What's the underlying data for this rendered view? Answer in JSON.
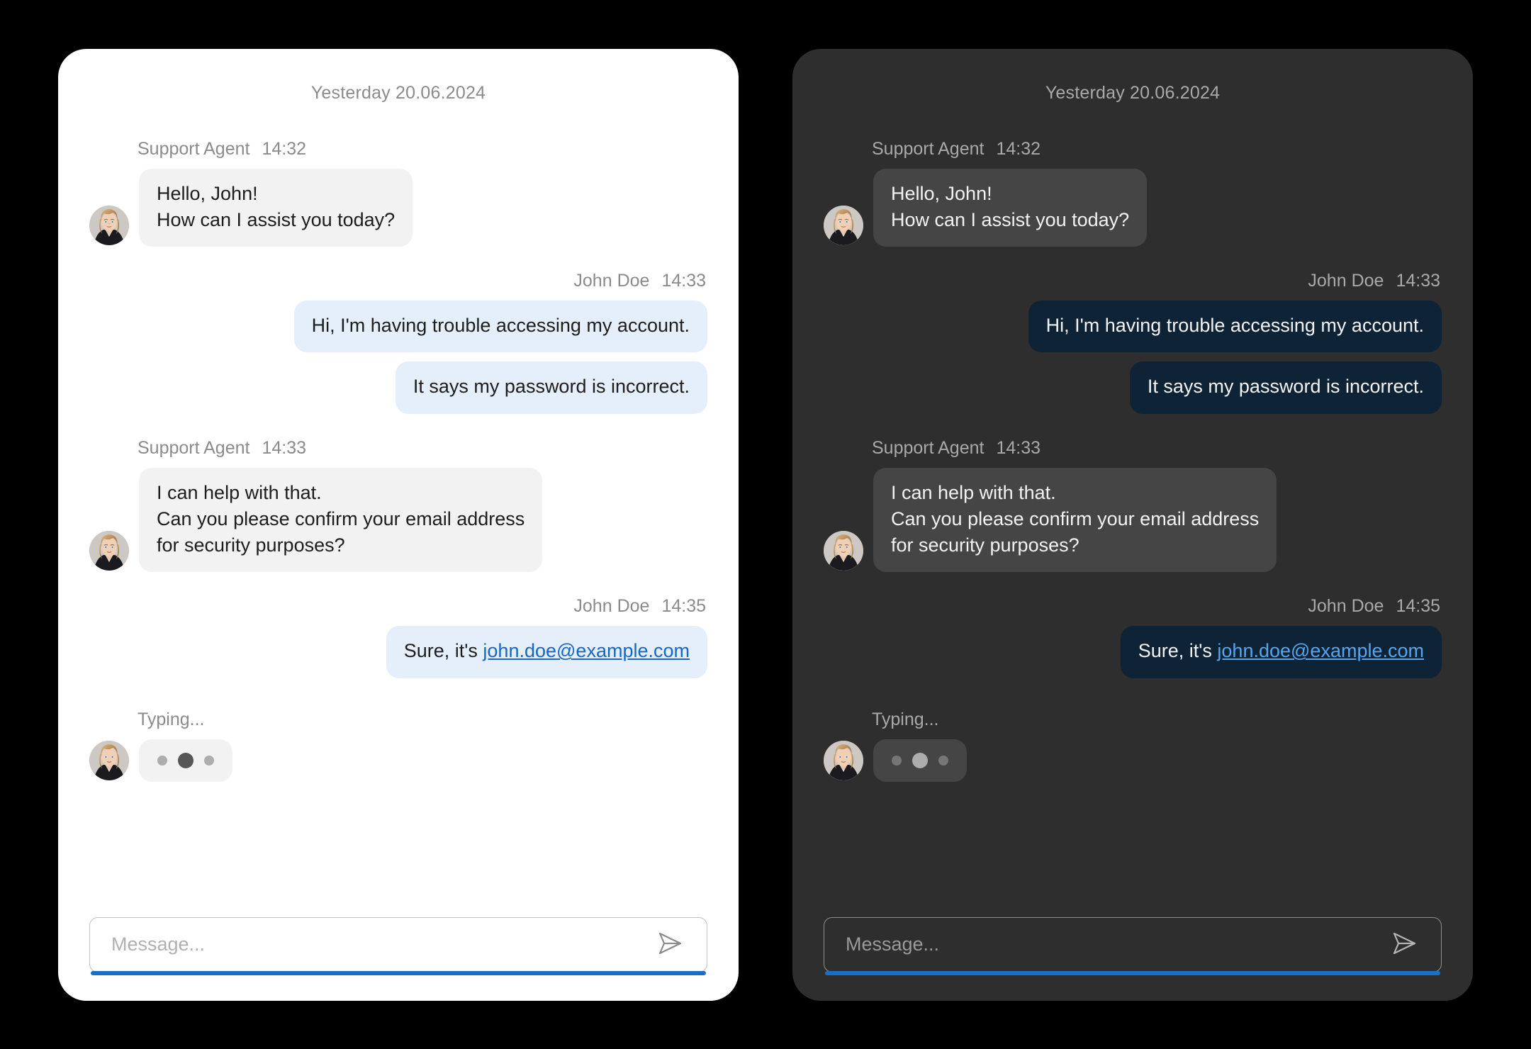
{
  "panels": [
    {
      "theme": "light",
      "name": "chat-panel-light"
    },
    {
      "theme": "dark",
      "name": "chat-panel-dark"
    }
  ],
  "date_divider": "Yesterday 20.06.2024",
  "messages": [
    {
      "side": "in",
      "sender": "Support Agent",
      "time": "14:32",
      "bubbles": [
        "Hello, John!\nHow can I assist you today?"
      ]
    },
    {
      "side": "out",
      "sender": "John Doe",
      "time": "14:33",
      "bubbles": [
        "Hi, I'm having trouble accessing my account.",
        "It says my password is incorrect."
      ]
    },
    {
      "side": "in",
      "sender": "Support Agent",
      "time": "14:33",
      "bubbles": [
        "I can help with that.\nCan you please confirm your email address\nfor security purposes?"
      ]
    },
    {
      "side": "out",
      "sender": "John Doe",
      "time": "14:35",
      "bubbles": [],
      "link_message": {
        "prefix": "Sure, it's ",
        "link": "john.doe@example.com"
      }
    }
  ],
  "typing": {
    "label": "Typing...",
    "dots": [
      "small",
      "large",
      "small"
    ]
  },
  "composer": {
    "value": "",
    "placeholder": "Message...",
    "send_icon": "send-paper-plane-icon"
  },
  "avatar": {
    "icon": "support-agent-avatar",
    "alt": "Support Agent portrait"
  },
  "colors": {
    "page_background": "#000000",
    "light_panel_bg": "#ffffff",
    "dark_panel_bg": "#2e2e2e",
    "incoming_bubble_light": "#f2f2f2",
    "incoming_bubble_dark": "#454545",
    "outgoing_bubble_light": "#e5eefb",
    "outgoing_bubble_dark": "#0e2336",
    "link_light": "#1567c8",
    "link_dark": "#56a6ef",
    "accent_underline": "#1a6fc4",
    "meta_text_light": "#8b8b8b",
    "meta_text_dark": "#a9a9a9"
  }
}
